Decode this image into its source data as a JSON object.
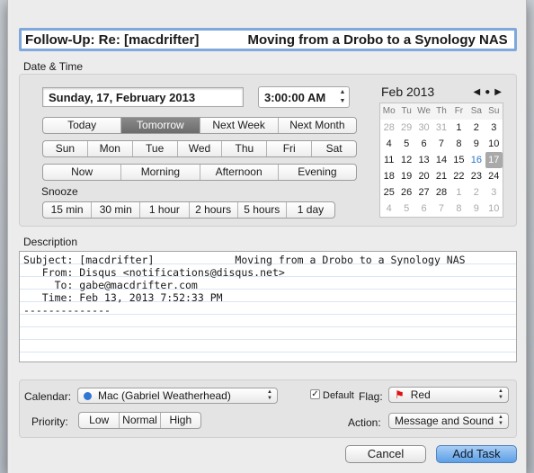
{
  "title": "Follow-Up: Re: [macdrifter]             Moving from a Drobo to a Synology NAS",
  "date_time": {
    "label": "Date & Time",
    "date": "Sunday, 17, February 2013",
    "time": "3:00:00 AM",
    "relative": [
      {
        "label": "Today",
        "selected": false
      },
      {
        "label": "Tomorrow",
        "selected": true
      },
      {
        "label": "Next Week",
        "selected": false
      },
      {
        "label": "Next Month",
        "selected": false
      }
    ],
    "weekdays": [
      "Sun",
      "Mon",
      "Tue",
      "Wed",
      "Thu",
      "Fri",
      "Sat"
    ],
    "times_of_day": [
      "Now",
      "Morning",
      "Afternoon",
      "Evening"
    ],
    "snooze_label": "Snooze",
    "snooze": [
      "15 min",
      "30 min",
      "1 hour",
      "2 hours",
      "5 hours",
      "1 day"
    ]
  },
  "calendar": {
    "month": "Feb 2013",
    "nav": {
      "prev": "◀",
      "today": "●",
      "next": "▶"
    },
    "days_of_week": [
      "Mo",
      "Tu",
      "We",
      "Th",
      "Fr",
      "Sa",
      "Su"
    ],
    "weeks": [
      [
        "28",
        "29",
        "30",
        "31",
        "1",
        "2",
        "3"
      ],
      [
        "4",
        "5",
        "6",
        "7",
        "8",
        "9",
        "10"
      ],
      [
        "11",
        "12",
        "13",
        "14",
        "15",
        "16",
        "17"
      ],
      [
        "18",
        "19",
        "20",
        "21",
        "22",
        "23",
        "24"
      ],
      [
        "25",
        "26",
        "27",
        "28",
        "1",
        "2",
        "3"
      ],
      [
        "4",
        "5",
        "6",
        "7",
        "8",
        "9",
        "10"
      ]
    ],
    "today": "16",
    "selected": "17"
  },
  "description": {
    "label": "Description",
    "lines": [
      "Subject: [macdrifter]             Moving from a Drobo to a Synology NAS",
      "   From: Disqus <notifications@disqus.net>",
      "     To: gabe@macdrifter.com",
      "   Time: Feb 13, 2013 7:52:33 PM",
      "--------------"
    ]
  },
  "calendar_select": {
    "label": "Calendar:",
    "value": "Mac (Gabriel Weatherhead)",
    "color": "#2f76d4"
  },
  "default_checkbox": {
    "label": "Default",
    "checked": true
  },
  "flag": {
    "label": "Flag:",
    "value": "Red",
    "icon": "red-flag-icon"
  },
  "priority": {
    "label": "Priority:",
    "options": [
      "Low",
      "Normal",
      "High"
    ]
  },
  "action": {
    "label": "Action:",
    "value": "Message and Sound"
  },
  "buttons": {
    "cancel": "Cancel",
    "add": "Add Task"
  }
}
